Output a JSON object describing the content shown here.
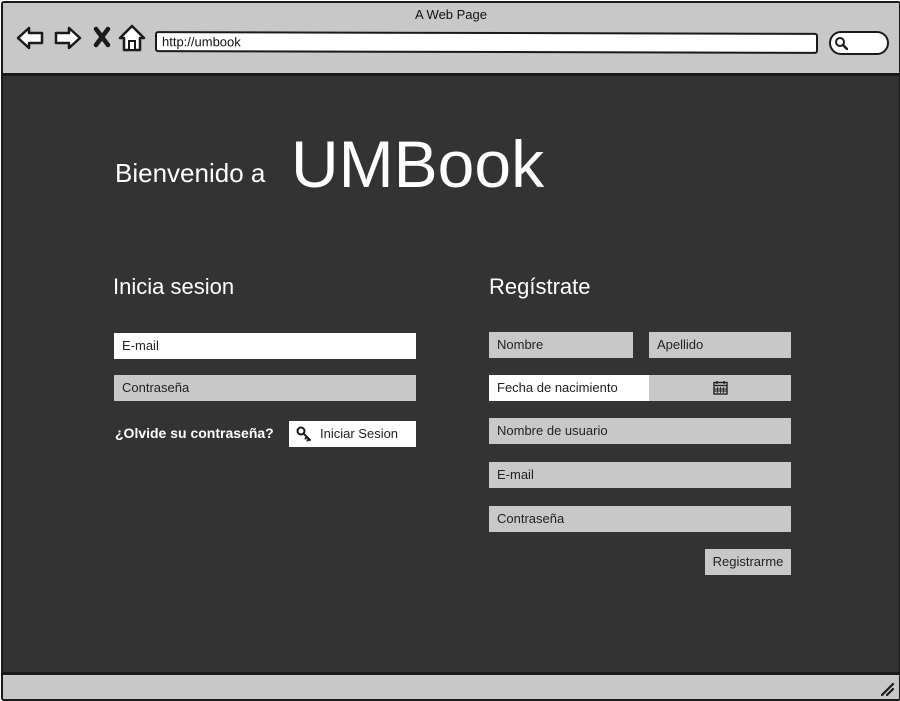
{
  "browser": {
    "window_title": "A Web Page",
    "url": "http://umbook"
  },
  "hero": {
    "welcome": "Bienvenido a",
    "brand": "UMBook"
  },
  "login": {
    "heading": "Inicia sesion",
    "email_placeholder": "E-mail",
    "password_placeholder": "Contraseña",
    "forgot_link": "¿Olvide su contraseña?",
    "submit_label": "Iniciar Sesion"
  },
  "register": {
    "heading": "Regístrate",
    "first_name_placeholder": "Nombre",
    "last_name_placeholder": "Apellido",
    "birthdate_placeholder": "Fecha de nacimiento",
    "username_placeholder": "Nombre de usuario",
    "email_placeholder": "E-mail",
    "password_placeholder": "Contraseña",
    "submit_label": "Registrarme"
  },
  "icons": {
    "back": "back-arrow-icon",
    "forward": "forward-arrow-icon",
    "stop": "close-icon",
    "home": "home-icon",
    "search": "search-icon",
    "key": "key-icon",
    "calendar": "calendar-icon",
    "resize": "resize-grip-icon"
  },
  "colors": {
    "content_background": "#333333",
    "chrome": "#c8c8c8",
    "field_gray": "#c8c8c8",
    "field_white": "#ffffff",
    "text_on_dark": "#ffffff"
  }
}
